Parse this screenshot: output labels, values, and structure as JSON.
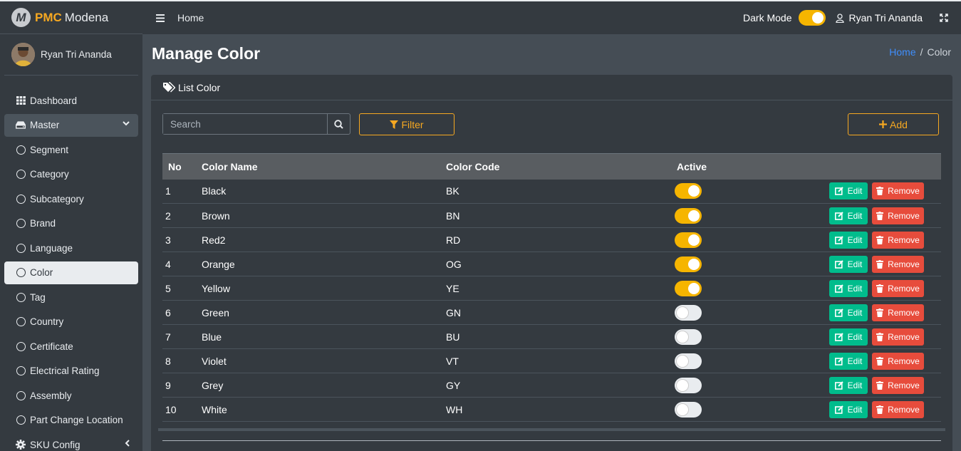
{
  "brand": {
    "pmc": "PMC",
    "rest": "Modena",
    "logo_letter": "M"
  },
  "sidebar": {
    "user_name": "Ryan Tri Ananda",
    "items": [
      {
        "label": "Dashboard",
        "icon": "grid-icon"
      },
      {
        "label": "Master",
        "icon": "drive-icon",
        "state": "open"
      },
      {
        "label": "Segment",
        "icon": "circle-icon"
      },
      {
        "label": "Category",
        "icon": "circle-icon"
      },
      {
        "label": "Subcategory",
        "icon": "circle-icon"
      },
      {
        "label": "Brand",
        "icon": "circle-icon"
      },
      {
        "label": "Language",
        "icon": "circle-icon"
      },
      {
        "label": "Color",
        "icon": "circle-icon",
        "state": "active"
      },
      {
        "label": "Tag",
        "icon": "circle-icon"
      },
      {
        "label": "Country",
        "icon": "circle-icon"
      },
      {
        "label": "Certificate",
        "icon": "circle-icon"
      },
      {
        "label": "Electrical Rating",
        "icon": "circle-icon"
      },
      {
        "label": "Assembly",
        "icon": "circle-icon"
      },
      {
        "label": "Part Change Location",
        "icon": "circle-icon"
      },
      {
        "label": "SKU Config",
        "icon": "gear-icon"
      }
    ]
  },
  "header": {
    "home": "Home",
    "dark_mode_label": "Dark Mode",
    "dark_mode_on": true,
    "user_name": "Ryan Tri Ananda"
  },
  "page": {
    "title": "Manage Color",
    "breadcrumb": {
      "home": "Home",
      "sep": "/",
      "current": "Color"
    }
  },
  "card": {
    "title": "List Color",
    "search_placeholder": "Search",
    "filter_label": "Filter",
    "add_label": "Add",
    "columns": [
      "No",
      "Color Name",
      "Color Code",
      "Active"
    ],
    "rows": [
      {
        "no": "1",
        "name": "Black",
        "code": "BK",
        "active": true
      },
      {
        "no": "2",
        "name": "Brown",
        "code": "BN",
        "active": true
      },
      {
        "no": "3",
        "name": "Red2",
        "code": "RD",
        "active": true
      },
      {
        "no": "4",
        "name": "Orange",
        "code": "OG",
        "active": true
      },
      {
        "no": "5",
        "name": "Yellow",
        "code": "YE",
        "active": true
      },
      {
        "no": "6",
        "name": "Green",
        "code": "GN",
        "active": false
      },
      {
        "no": "7",
        "name": "Blue",
        "code": "BU",
        "active": false
      },
      {
        "no": "8",
        "name": "Violet",
        "code": "VT",
        "active": false
      },
      {
        "no": "9",
        "name": "Grey",
        "code": "GY",
        "active": false
      },
      {
        "no": "10",
        "name": "White",
        "code": "WH",
        "active": false
      }
    ],
    "edit_label": "Edit",
    "remove_label": "Remove"
  },
  "colors": {
    "accent": "#f6a821",
    "edit": "#00bc8c",
    "remove": "#e74c3c",
    "toggle_on": "#f6b500",
    "link": "#3f8efc"
  }
}
